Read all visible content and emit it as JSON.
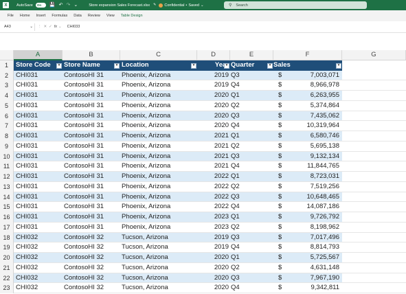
{
  "titlebar": {
    "autosave_label": "AutoSave",
    "autosave_state": "On",
    "filename": "Store expansion Sales Forecast.xlsx",
    "sensitivity": "Confidential",
    "saved_status": "Saved",
    "search_placeholder": "Search"
  },
  "ribbon": {
    "tabs": [
      "File",
      "Home",
      "Insert",
      "Formulas",
      "Data",
      "Review",
      "View",
      "Table Design"
    ]
  },
  "formula_bar": {
    "name_box": "A43",
    "fx": "fx",
    "value": "CHI033"
  },
  "columns": [
    "A",
    "B",
    "C",
    "D",
    "E",
    "F",
    "G"
  ],
  "selected_column": "A",
  "table": {
    "headers": [
      "Store Code",
      "Store Name",
      "Location",
      "Year",
      "Quarter",
      "Sales"
    ],
    "currency_symbol": "$",
    "rows": [
      {
        "n": "2",
        "code": "CHI031",
        "name": "ContosoHI 31",
        "loc": "Phoenix, Arizona",
        "year": "2019",
        "q": "Q3",
        "sales": "7,003,071"
      },
      {
        "n": "3",
        "code": "CHI031",
        "name": "ContosoHI 31",
        "loc": "Phoenix, Arizona",
        "year": "2019",
        "q": "Q4",
        "sales": "8,966,978"
      },
      {
        "n": "4",
        "code": "CHI031",
        "name": "ContosoHI 31",
        "loc": "Phoenix, Arizona",
        "year": "2020",
        "q": "Q1",
        "sales": "6,263,955"
      },
      {
        "n": "5",
        "code": "CHI031",
        "name": "ContosoHI 31",
        "loc": "Phoenix, Arizona",
        "year": "2020",
        "q": "Q2",
        "sales": "5,374,864"
      },
      {
        "n": "6",
        "code": "CHI031",
        "name": "ContosoHI 31",
        "loc": "Phoenix, Arizona",
        "year": "2020",
        "q": "Q3",
        "sales": "7,435,062"
      },
      {
        "n": "7",
        "code": "CHI031",
        "name": "ContosoHI 31",
        "loc": "Phoenix, Arizona",
        "year": "2020",
        "q": "Q4",
        "sales": "10,319,964"
      },
      {
        "n": "8",
        "code": "CHI031",
        "name": "ContosoHI 31",
        "loc": "Phoenix, Arizona",
        "year": "2021",
        "q": "Q1",
        "sales": "6,580,746"
      },
      {
        "n": "9",
        "code": "CHI031",
        "name": "ContosoHI 31",
        "loc": "Phoenix, Arizona",
        "year": "2021",
        "q": "Q2",
        "sales": "5,695,138"
      },
      {
        "n": "10",
        "code": "CHI031",
        "name": "ContosoHI 31",
        "loc": "Phoenix, Arizona",
        "year": "2021",
        "q": "Q3",
        "sales": "9,132,134"
      },
      {
        "n": "11",
        "code": "CHI031",
        "name": "ContosoHI 31",
        "loc": "Phoenix, Arizona",
        "year": "2021",
        "q": "Q4",
        "sales": "11,844,765"
      },
      {
        "n": "12",
        "code": "CHI031",
        "name": "ContosoHI 31",
        "loc": "Phoenix, Arizona",
        "year": "2022",
        "q": "Q1",
        "sales": "8,723,031"
      },
      {
        "n": "13",
        "code": "CHI031",
        "name": "ContosoHI 31",
        "loc": "Phoenix, Arizona",
        "year": "2022",
        "q": "Q2",
        "sales": "7,519,256"
      },
      {
        "n": "14",
        "code": "CHI031",
        "name": "ContosoHI 31",
        "loc": "Phoenix, Arizona",
        "year": "2022",
        "q": "Q3",
        "sales": "10,648,465"
      },
      {
        "n": "15",
        "code": "CHI031",
        "name": "ContosoHI 31",
        "loc": "Phoenix, Arizona",
        "year": "2022",
        "q": "Q4",
        "sales": "14,087,186"
      },
      {
        "n": "16",
        "code": "CHI031",
        "name": "ContosoHI 31",
        "loc": "Phoenix, Arizona",
        "year": "2023",
        "q": "Q1",
        "sales": "9,726,792"
      },
      {
        "n": "17",
        "code": "CHI031",
        "name": "ContosoHI 31",
        "loc": "Phoenix, Arizona",
        "year": "2023",
        "q": "Q2",
        "sales": "8,198,962"
      },
      {
        "n": "18",
        "code": "CHI032",
        "name": "ContosoHI 32",
        "loc": "Tucson, Arizona",
        "year": "2019",
        "q": "Q3",
        "sales": "7,017,496"
      },
      {
        "n": "19",
        "code": "CHI032",
        "name": "ContosoHI 32",
        "loc": "Tucson, Arizona",
        "year": "2019",
        "q": "Q4",
        "sales": "8,814,793"
      },
      {
        "n": "20",
        "code": "CHI032",
        "name": "ContosoHI 32",
        "loc": "Tucson, Arizona",
        "year": "2020",
        "q": "Q1",
        "sales": "5,725,567"
      },
      {
        "n": "21",
        "code": "CHI032",
        "name": "ContosoHI 32",
        "loc": "Tucson, Arizona",
        "year": "2020",
        "q": "Q2",
        "sales": "4,631,148"
      },
      {
        "n": "22",
        "code": "CHI032",
        "name": "ContosoHI 32",
        "loc": "Tucson, Arizona",
        "year": "2020",
        "q": "Q3",
        "sales": "7,967,190"
      },
      {
        "n": "23",
        "code": "CHI032",
        "name": "ContosoHI 32",
        "loc": "Tucson, Arizona",
        "year": "2020",
        "q": "Q4",
        "sales": "9,342,811"
      }
    ]
  },
  "colors": {
    "excel_green": "#1e7145",
    "table_header": "#1f4e79",
    "band_light": "#dcebf7",
    "band_dark": "#c5e0f4"
  }
}
